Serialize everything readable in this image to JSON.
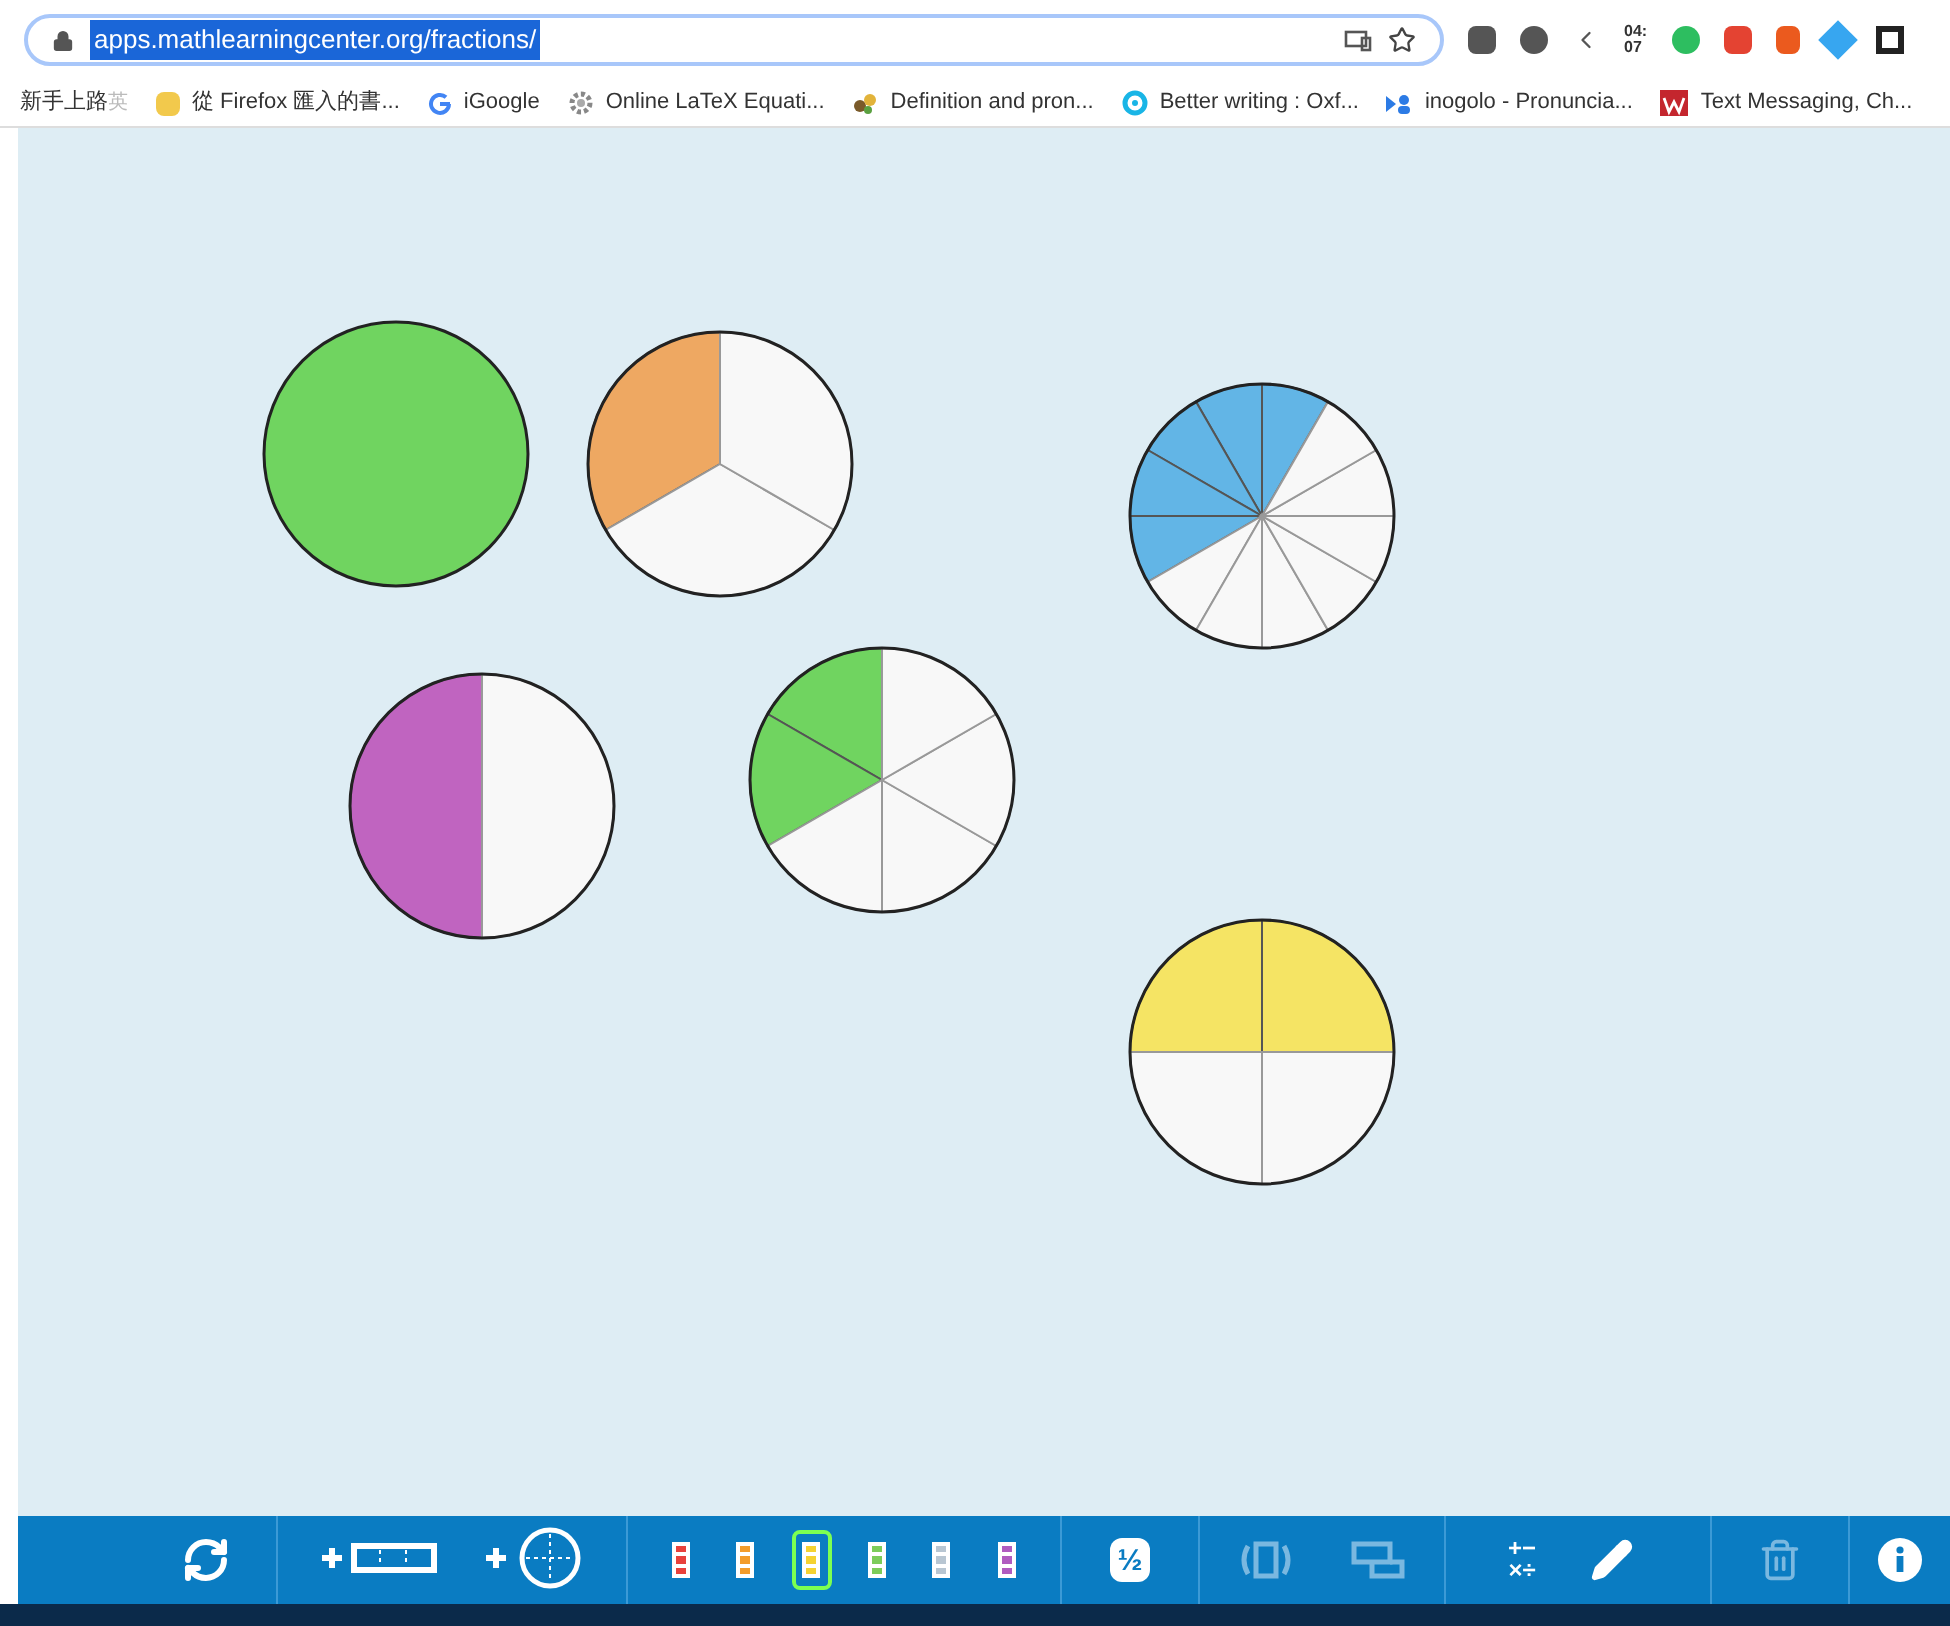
{
  "browser": {
    "url": "apps.mathlearningcenter.org/fractions/",
    "url_selected": true,
    "extension_badge": "04:\n07"
  },
  "bookmarks": [
    {
      "label": "新手上路",
      "kind": "plain"
    },
    {
      "label": "英",
      "kind": "ime"
    },
    {
      "label": "從 Firefox 匯入的書...",
      "kind": "folder"
    },
    {
      "label": "iGoogle",
      "kind": "google"
    },
    {
      "label": "Online LaTeX Equati...",
      "kind": "gear"
    },
    {
      "label": "Definition and pron...",
      "kind": "dots"
    },
    {
      "label": "Better writing : Oxf...",
      "kind": "ring"
    },
    {
      "label": "inogolo - Pronuncia...",
      "kind": "people"
    },
    {
      "label": "Text Messaging, Ch...",
      "kind": "w"
    }
  ],
  "circles": [
    {
      "color": "#70d460",
      "pieces": [
        {
          "filled": true
        }
      ]
    },
    {
      "color": "#eea862",
      "pieces": [
        {
          "filled": true
        },
        {
          "filled": false
        },
        {
          "filled": false
        }
      ]
    },
    {
      "color": "#62b5e6",
      "pieces": [
        {
          "filled": true
        },
        {
          "filled": true
        },
        {
          "filled": true
        },
        {
          "filled": true
        },
        {
          "filled": true
        },
        {
          "filled": false
        },
        {
          "filled": false
        },
        {
          "filled": false
        },
        {
          "filled": false
        },
        {
          "filled": false
        },
        {
          "filled": false
        },
        {
          "filled": false
        }
      ]
    },
    {
      "color": "#c064c0",
      "pieces": [
        {
          "filled": true
        },
        {
          "filled": false
        }
      ]
    },
    {
      "color": "#70d460",
      "pieces": [
        {
          "filled": true
        },
        {
          "filled": true
        },
        {
          "filled": false
        },
        {
          "filled": false
        },
        {
          "filled": false
        },
        {
          "filled": false
        }
      ]
    },
    {
      "color": "#f5e464",
      "pieces": [
        {
          "filled": true
        },
        {
          "filled": true
        },
        {
          "filled": false
        },
        {
          "filled": false
        }
      ]
    }
  ],
  "toolbar": {
    "colors": [
      {
        "color": "#e8413c",
        "selected": false
      },
      {
        "color": "#f39c2b",
        "selected": false
      },
      {
        "color": "#f5d230",
        "selected": true
      },
      {
        "color": "#7ccc5a",
        "selected": false
      },
      {
        "color": "#b8c6d2",
        "selected": false
      },
      {
        "color": "#b05cc0",
        "selected": false
      }
    ],
    "fraction_label": "½",
    "math_top": "+−",
    "math_bottom": "×÷",
    "tools": [
      {
        "kind": "flip",
        "disabled": true
      },
      {
        "kind": "group",
        "disabled": true
      },
      {
        "kind": "pencil",
        "disabled": false
      },
      {
        "kind": "trash",
        "disabled": true
      }
    ]
  }
}
